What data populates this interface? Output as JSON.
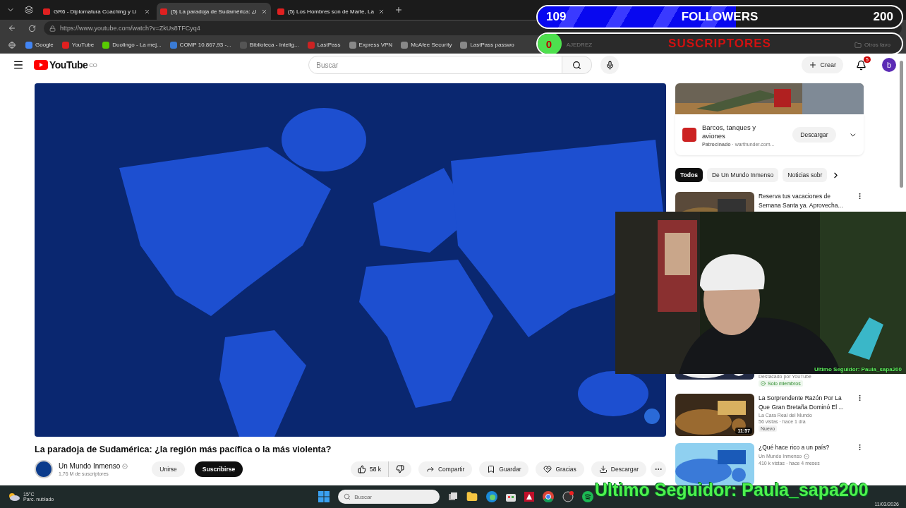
{
  "browser": {
    "tabs": [
      {
        "title": "GR6 - Diplomatura Coaching y Li",
        "selected": false
      },
      {
        "title": "(5) La paradoja de Sudamérica: ¿l",
        "selected": true
      },
      {
        "title": "(5) Los Hombres son de Marte, La",
        "selected": false
      }
    ],
    "url": "https://www.youtube.com/watch?v=ZkUs8TFCyq4",
    "bookmarks": [
      "Google",
      "YouTube",
      "Duolingo - La mej...",
      "COMP 10.867,93 -...",
      "Biblioteca - Intelig...",
      "LastPass",
      "Express VPN",
      "McAfee Security",
      "LastPass passwo"
    ],
    "bookmark_folder": "AJEDREZ",
    "other_bookmarks": "Otros favo"
  },
  "youtube": {
    "logo": "YouTube",
    "region": "CO",
    "search": {
      "placeholder": "Buscar"
    },
    "create": "Crear",
    "notifications": "5",
    "avatar": "b",
    "video": {
      "title": "La paradoja de Sudamérica: ¿la región más pacífica o la más violenta?",
      "channel": "Un Mundo Inmenso",
      "verified": true,
      "subscribers": "1,76 M de suscriptores",
      "join": "Unirse",
      "subscribe": "Suscribirse",
      "likes": "58 k",
      "actions": [
        "Compartir",
        "Guardar",
        "Gracias",
        "Descargar"
      ]
    },
    "ad": {
      "title": "Barcos, tanques y aviones",
      "sponsor_line": "**Patrocinado** · warthunder.com...",
      "button": "Descargar"
    },
    "chips": [
      {
        "label": "Todos",
        "selected": true
      },
      {
        "label": "De Un Mundo Inmenso",
        "selected": false
      },
      {
        "label": "Noticias sobr",
        "selected": false
      }
    ],
    "recommendations": [
      {
        "title": "Reserva tus vacaciones de Semana Santa ya. Aprovecha..."
      },
      {
        "channel": "Destacado por YouTube",
        "badge": {
          "text": "Solo miembros",
          "kind": "members"
        }
      },
      {
        "title": "La Sorprendente Razón Por La Que Gran Bretaña Dominó El ...",
        "channel": "La Cara Real del Mundo",
        "verified": false,
        "meta": "56 vistas · hace 1 día",
        "badge": {
          "text": "Nuevo",
          "kind": "new"
        },
        "duration": "11:57"
      },
      {
        "title": "¿Qué hace rico a un país?",
        "channel": "Un Mundo Inmenso",
        "verified": true,
        "meta": "410 k vistas · hace 4 meses"
      }
    ]
  },
  "overlay": {
    "followers": {
      "count": "109",
      "label": "FOLLOWERS",
      "goal": "200",
      "level": 0.545
    },
    "subscribers": {
      "count": "0",
      "label": "SUSCRIPTORES"
    },
    "webcam": {
      "kind": "picture",
      "last_follower": "Ultimo Seguidor: Paula_sapa200"
    },
    "last_follower": "Ultimo Seguidor: Paula_sapa200"
  },
  "taskbar": {
    "temperature": "15°C",
    "weather": "Parc. nublado",
    "search_placeholder": "Buscar",
    "date": "11/03/2026"
  }
}
